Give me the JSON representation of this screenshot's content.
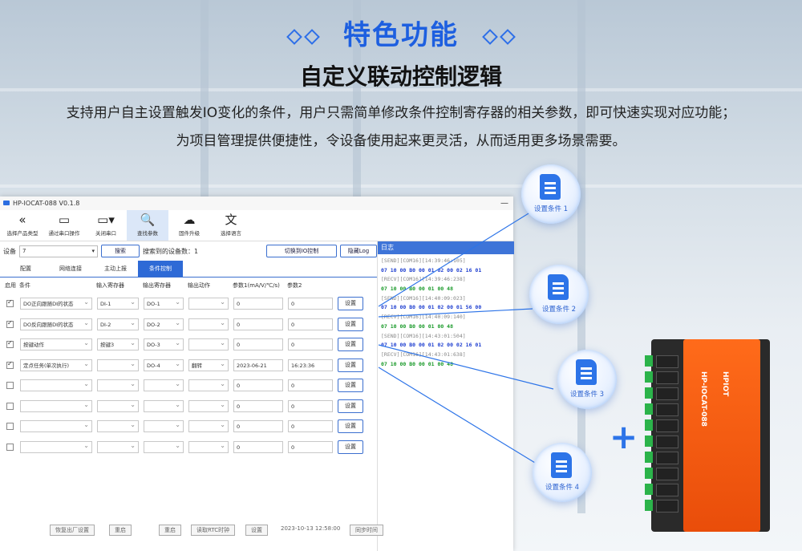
{
  "header": {
    "title": "特色功能",
    "subtitle": "自定义联动控制逻辑",
    "desc_line1": "支持用户自主设置触发IO变化的条件，用户只需简单修改条件控制寄存器的相关参数，即可快速实现对应功能；",
    "desc_line2": "为项目管理提供便捷性，令设备使用起来更灵活，从而适用更多场景需要。"
  },
  "window": {
    "title": "HP-IOCAT-088 V0.1.8",
    "toolbar": [
      {
        "label": "选择产品类型",
        "icon": "back-circle-icon"
      },
      {
        "label": "通过串口操作",
        "icon": "serial-port-icon"
      },
      {
        "label": "关闭串口",
        "icon": "serial-port-icon"
      },
      {
        "label": "查找参数",
        "icon": "search-doc-icon"
      },
      {
        "label": "固件升级",
        "icon": "cloud-upload-icon"
      },
      {
        "label": "选择语言",
        "icon": "language-icon"
      }
    ],
    "device_label": "设备",
    "device_value": "7",
    "search_btn": "搜索",
    "found_count": "搜索到的设备数：1",
    "switch_btn": "切换到IO控制",
    "hide_log_btn": "隐藏Log",
    "tabs": [
      "配置",
      "网络连接",
      "主动上报",
      "条件控制"
    ],
    "active_tab": "条件控制",
    "columns": [
      "启用",
      "条件",
      "输入寄存器",
      "输出寄存器",
      "输出动作",
      "参数1(mA/V/℃/s)",
      "参数2"
    ],
    "rows": [
      {
        "checked": true,
        "cond": "DO正向跟随DI的状态",
        "input": "DI-1",
        "output": "DO-1",
        "action": "",
        "p1": "0",
        "p2": "0",
        "btn": "设置"
      },
      {
        "checked": true,
        "cond": "DO反向跟随DI的状态",
        "input": "DI-2",
        "output": "DO-2",
        "action": "",
        "p1": "0",
        "p2": "0",
        "btn": "设置"
      },
      {
        "checked": true,
        "cond": "按键动作",
        "input": "按键3",
        "output": "DO-3",
        "action": "",
        "p1": "0",
        "p2": "0",
        "btn": "设置"
      },
      {
        "checked": true,
        "cond": "定点任务(单次执行)",
        "input": "",
        "output": "DO-4",
        "action": "翻转",
        "p1": "2023-06-21",
        "p2": "16:23:36",
        "btn": "设置"
      },
      {
        "checked": false,
        "cond": "",
        "input": "",
        "output": "",
        "action": "",
        "p1": "0",
        "p2": "0",
        "btn": "设置"
      },
      {
        "checked": false,
        "cond": "",
        "input": "",
        "output": "",
        "action": "",
        "p1": "0",
        "p2": "0",
        "btn": "设置"
      },
      {
        "checked": false,
        "cond": "",
        "input": "",
        "output": "",
        "action": "",
        "p1": "0",
        "p2": "0",
        "btn": "设置"
      },
      {
        "checked": false,
        "cond": "",
        "input": "",
        "output": "",
        "action": "",
        "p1": "0",
        "p2": "0",
        "btn": "设置"
      }
    ],
    "log_title": "日志",
    "log_lines": [
      {
        "t": "[SEND][COM16][14:39:46:105]",
        "c": "gray"
      },
      {
        "t": "07 10 00 B0 00 01 02 00 02 16 01",
        "c": "blue"
      },
      {
        "t": "[RECV][COM16][14:39:46:238]",
        "c": "gray"
      },
      {
        "t": "07 10 00 B0 00 01 00 48",
        "c": "green"
      },
      {
        "t": "[SEND][COM16][14:40:09:023]",
        "c": "gray"
      },
      {
        "t": "07 10 00 B0 00 01 02 00 01 56 00",
        "c": "blue"
      },
      {
        "t": "[RECV][COM16][14:40:09:140]",
        "c": "gray"
      },
      {
        "t": "07 10 00 B0 00 01 00 48",
        "c": "green"
      },
      {
        "t": "[SEND][COM16][14:43:01:504]",
        "c": "gray"
      },
      {
        "t": "07 10 00 B0 00 01 02 00 02 16 01",
        "c": "blue"
      },
      {
        "t": "[RECV][COM16][14:43:01:638]",
        "c": "gray"
      },
      {
        "t": "07 10 00 B0 00 01 00 48",
        "c": "green"
      }
    ],
    "status": [
      "恢复出厂设置",
      "重启",
      "重启",
      "读取RTC时钟",
      "设置",
      "2023-10-13 12:58:00",
      "同步时间"
    ]
  },
  "bubbles": [
    "设置条件 1",
    "设置条件 2",
    "设置条件 3",
    "设置条件 4"
  ],
  "device": {
    "model": "HP-IOCAT-088",
    "brand": "HPIOT",
    "plus": "+"
  },
  "colors": {
    "accent": "#2d74e8",
    "title": "#1d5fe0",
    "device_orange": "#f05a10"
  }
}
